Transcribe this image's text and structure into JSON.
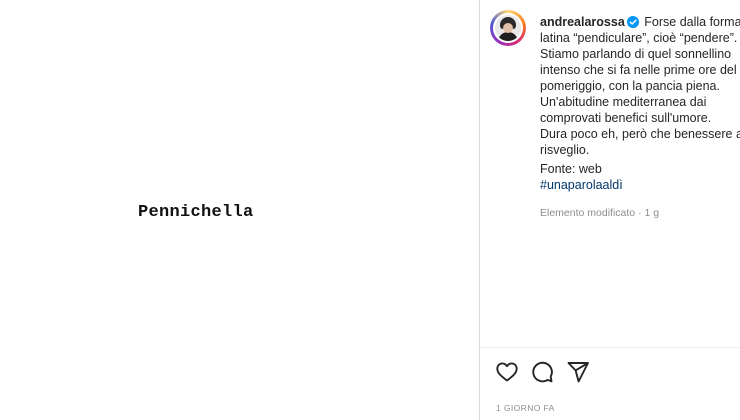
{
  "post": {
    "image_word": "Pennichella"
  },
  "caption": {
    "username": "andrealarossa",
    "verified_icon": "verified-badge-icon",
    "intro": "Forse dalla forma latina “pendiculare”, cioè “pendere”.",
    "body": "Stiamo parlando di quel sonnellino intenso che si fa nelle prime ore del pomeriggio, con la pancia piena.",
    "habit": "Un'abitudine mediterranea dai comprovati benefici sull'umore.",
    "closing": "Dura poco eh, però che benessere al risveglio.",
    "source": "Fonte: web",
    "hashtag": "#unaparolaaldì"
  },
  "meta": {
    "edited": "Elemento modificato",
    "separator": "·",
    "age": "1 g"
  },
  "actions": {
    "like_icon": "heart-icon",
    "comment_icon": "comment-icon",
    "share_icon": "paper-plane-icon"
  },
  "timestamp": "1 GIORNO FA",
  "colors": {
    "hashtag": "#00376b",
    "verified": "#0095f6",
    "muted": "#8e8e8e"
  }
}
